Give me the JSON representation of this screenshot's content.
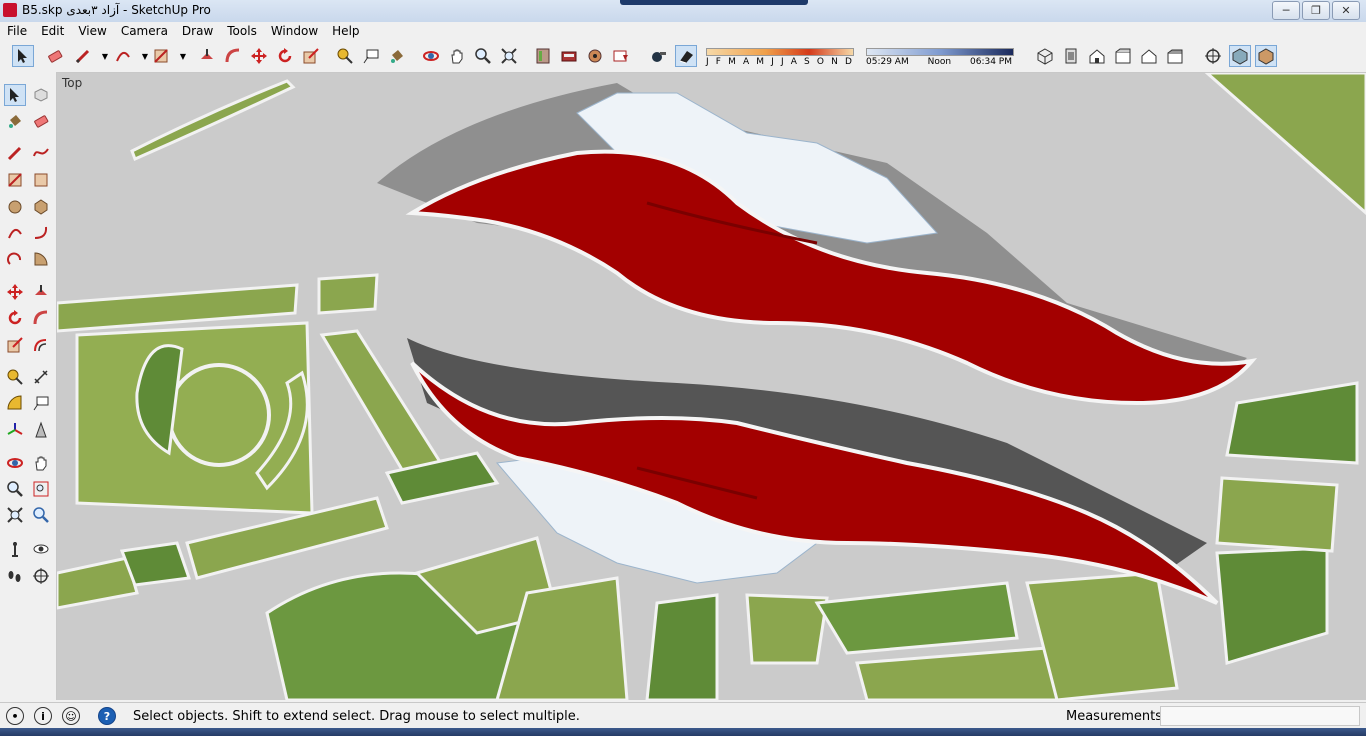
{
  "window": {
    "title": "B5.skp آزاد ۳بعدی - SketchUp Pro",
    "minimize": "─",
    "maximize": "❐",
    "close": "✕"
  },
  "menu": [
    "File",
    "Edit",
    "View",
    "Camera",
    "Draw",
    "Tools",
    "Window",
    "Help"
  ],
  "shadow_months": [
    "J",
    "F",
    "M",
    "A",
    "M",
    "J",
    "J",
    "A",
    "S",
    "O",
    "N",
    "D"
  ],
  "shadow_time": {
    "start": "05:29 AM",
    "noon": "Noon",
    "end": "06:34 PM"
  },
  "viewport": {
    "label": "Top"
  },
  "status": {
    "message": "Select objects. Shift to extend select. Drag mouse to select multiple.",
    "measurements_label": "Measurements",
    "measurements_value": "",
    "help": "?"
  },
  "colors": {
    "model_red": "#a30000",
    "grass": "#8aa64c",
    "pavement": "#cbcbcb",
    "selection": "#cfe2f5"
  }
}
